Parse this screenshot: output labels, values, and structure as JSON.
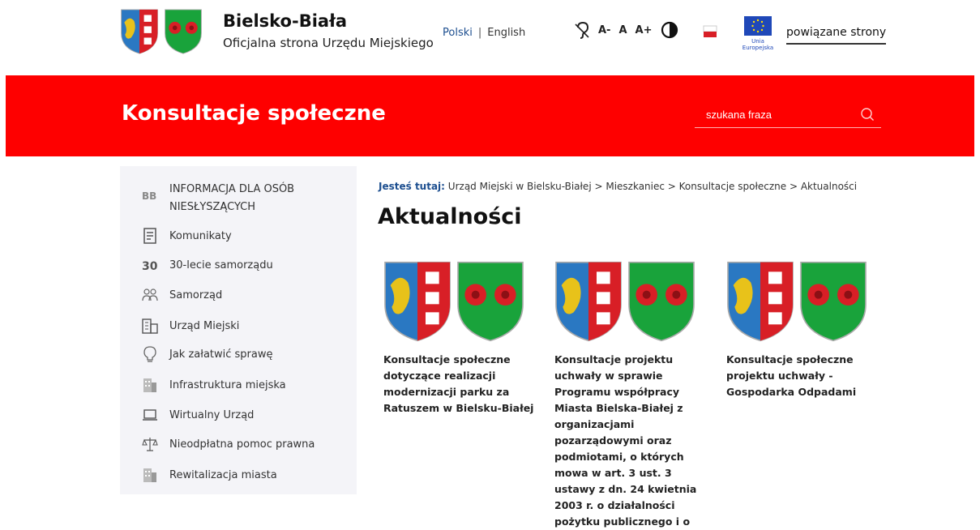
{
  "header": {
    "title": "Bielsko-Biała",
    "subtitle": "Oficjalna strona Urzędu Miejskiego",
    "lang_pl": "Polski",
    "lang_sep": "|",
    "lang_en": "English",
    "font_small": "A-",
    "font_normal": "A",
    "font_large": "A+",
    "ue_caption": "Unia Europejska",
    "related_link": "powiązane strony"
  },
  "band": {
    "title": "Konsultacje społeczne",
    "search_placeholder": "szukana fraza",
    "color": "#fe0000"
  },
  "sidebar": {
    "items": [
      {
        "label": "INFORMACJA DLA OSÓB NIESŁYSZĄCYCH",
        "icon": "bb-sign-icon"
      },
      {
        "label": "Komunikaty",
        "icon": "document-icon"
      },
      {
        "label": "30-lecie samorządu",
        "icon": "thirty-icon"
      },
      {
        "label": "Samorząd",
        "icon": "people-icon"
      },
      {
        "label": "Urząd Miejski",
        "icon": "building-icon"
      },
      {
        "label": "Jak załatwić sprawę",
        "icon": "lightbulb-icon"
      },
      {
        "label": "Infrastruktura miejska",
        "icon": "city-icon"
      },
      {
        "label": "Wirtualny Urząd",
        "icon": "laptop-icon"
      },
      {
        "label": "Nieodpłatna pomoc prawna",
        "icon": "scales-icon"
      },
      {
        "label": "Rewitalizacja miasta",
        "icon": "office-icon"
      }
    ]
  },
  "breadcrumb": {
    "lead": "Jesteś tutaj:",
    "path": "Urząd Miejski w Bielsku-Białej > Mieszkaniec > Konsultacje społeczne > Aktualności"
  },
  "main": {
    "heading": "Aktualności",
    "cards": [
      {
        "text": "Konsultacje społeczne dotyczące realizacji modernizacji parku za Ratuszem w Bielsku-Białej"
      },
      {
        "text": "Konsultacje projektu uchwały w sprawie Programu współpracy Miasta Bielska-Białej z organizacjami pozarządowymi oraz podmiotami, o których mowa w art. 3 ust. 3 ustawy z dn. 24 kwietnia 2003 r. o działalności pożytku publicznego i o"
      },
      {
        "text": "Konsultacje społeczne projektu uchwały - Gospodarka Odpadami"
      }
    ]
  },
  "colors": {
    "accent_blue": "#1c4e8f",
    "crest_red": "#d81f26",
    "crest_green": "#19a33b",
    "crest_blue": "#2a78c2"
  }
}
